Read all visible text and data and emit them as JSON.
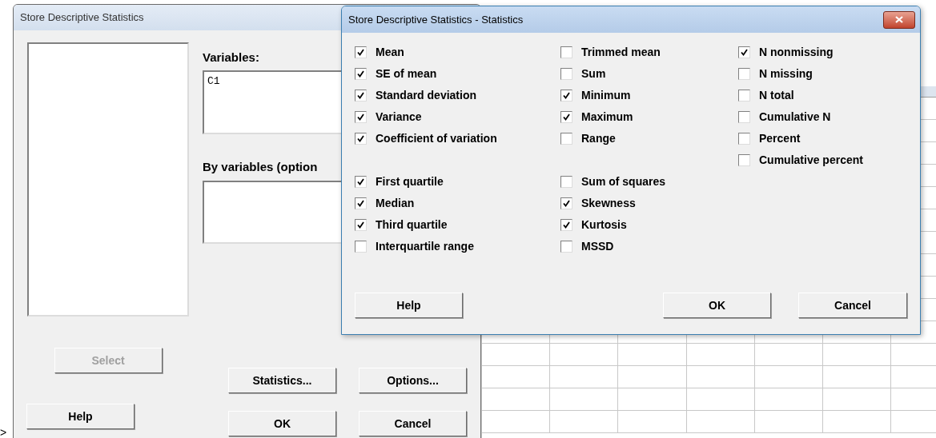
{
  "main_dialog": {
    "title": "Store Descriptive Statistics",
    "variables_label": "Variables:",
    "variables_value": "C1",
    "by_variables_label": "By variables (option",
    "select_button": {
      "label": "Select",
      "disabled": true
    },
    "statistics_button": {
      "label": "Statistics..."
    },
    "options_button": {
      "label": "Options..."
    },
    "help_button": {
      "label": "Help"
    },
    "ok_button": {
      "label": "OK"
    },
    "cancel_button": {
      "label": "Cancel"
    }
  },
  "statistics_dialog": {
    "title": "Store Descriptive Statistics - Statistics",
    "columns": [
      [
        [
          {
            "label": "Mean",
            "checked": true
          },
          {
            "label": "SE of mean",
            "checked": true
          },
          {
            "label": "Standard deviation",
            "checked": true
          },
          {
            "label": "Variance",
            "checked": true
          },
          {
            "label": "Coefficient of variation",
            "checked": true
          }
        ],
        [
          {
            "label": "First quartile",
            "checked": true
          },
          {
            "label": "Median",
            "checked": true
          },
          {
            "label": "Third quartile",
            "checked": true
          },
          {
            "label": "Interquartile range",
            "checked": false
          }
        ]
      ],
      [
        [
          {
            "label": "Trimmed mean",
            "checked": false
          },
          {
            "label": "Sum",
            "checked": false
          },
          {
            "label": "Minimum",
            "checked": true
          },
          {
            "label": "Maximum",
            "checked": true
          },
          {
            "label": "Range",
            "checked": false
          }
        ],
        [
          {
            "label": "Sum of squares",
            "checked": false
          },
          {
            "label": "Skewness",
            "checked": true
          },
          {
            "label": "Kurtosis",
            "checked": true
          },
          {
            "label": "MSSD",
            "checked": false
          }
        ]
      ],
      [
        [
          {
            "label": "N nonmissing",
            "checked": true
          },
          {
            "label": "N missing",
            "checked": false
          },
          {
            "label": "N total",
            "checked": false
          },
          {
            "label": "Cumulative N",
            "checked": false
          },
          {
            "label": "Percent",
            "checked": false
          },
          {
            "label": "Cumulative percent",
            "checked": false
          }
        ]
      ]
    ],
    "help_button": {
      "label": "Help"
    },
    "ok_button": {
      "label": "OK"
    },
    "cancel_button": {
      "label": "Cancel"
    }
  },
  "prompt": ">"
}
